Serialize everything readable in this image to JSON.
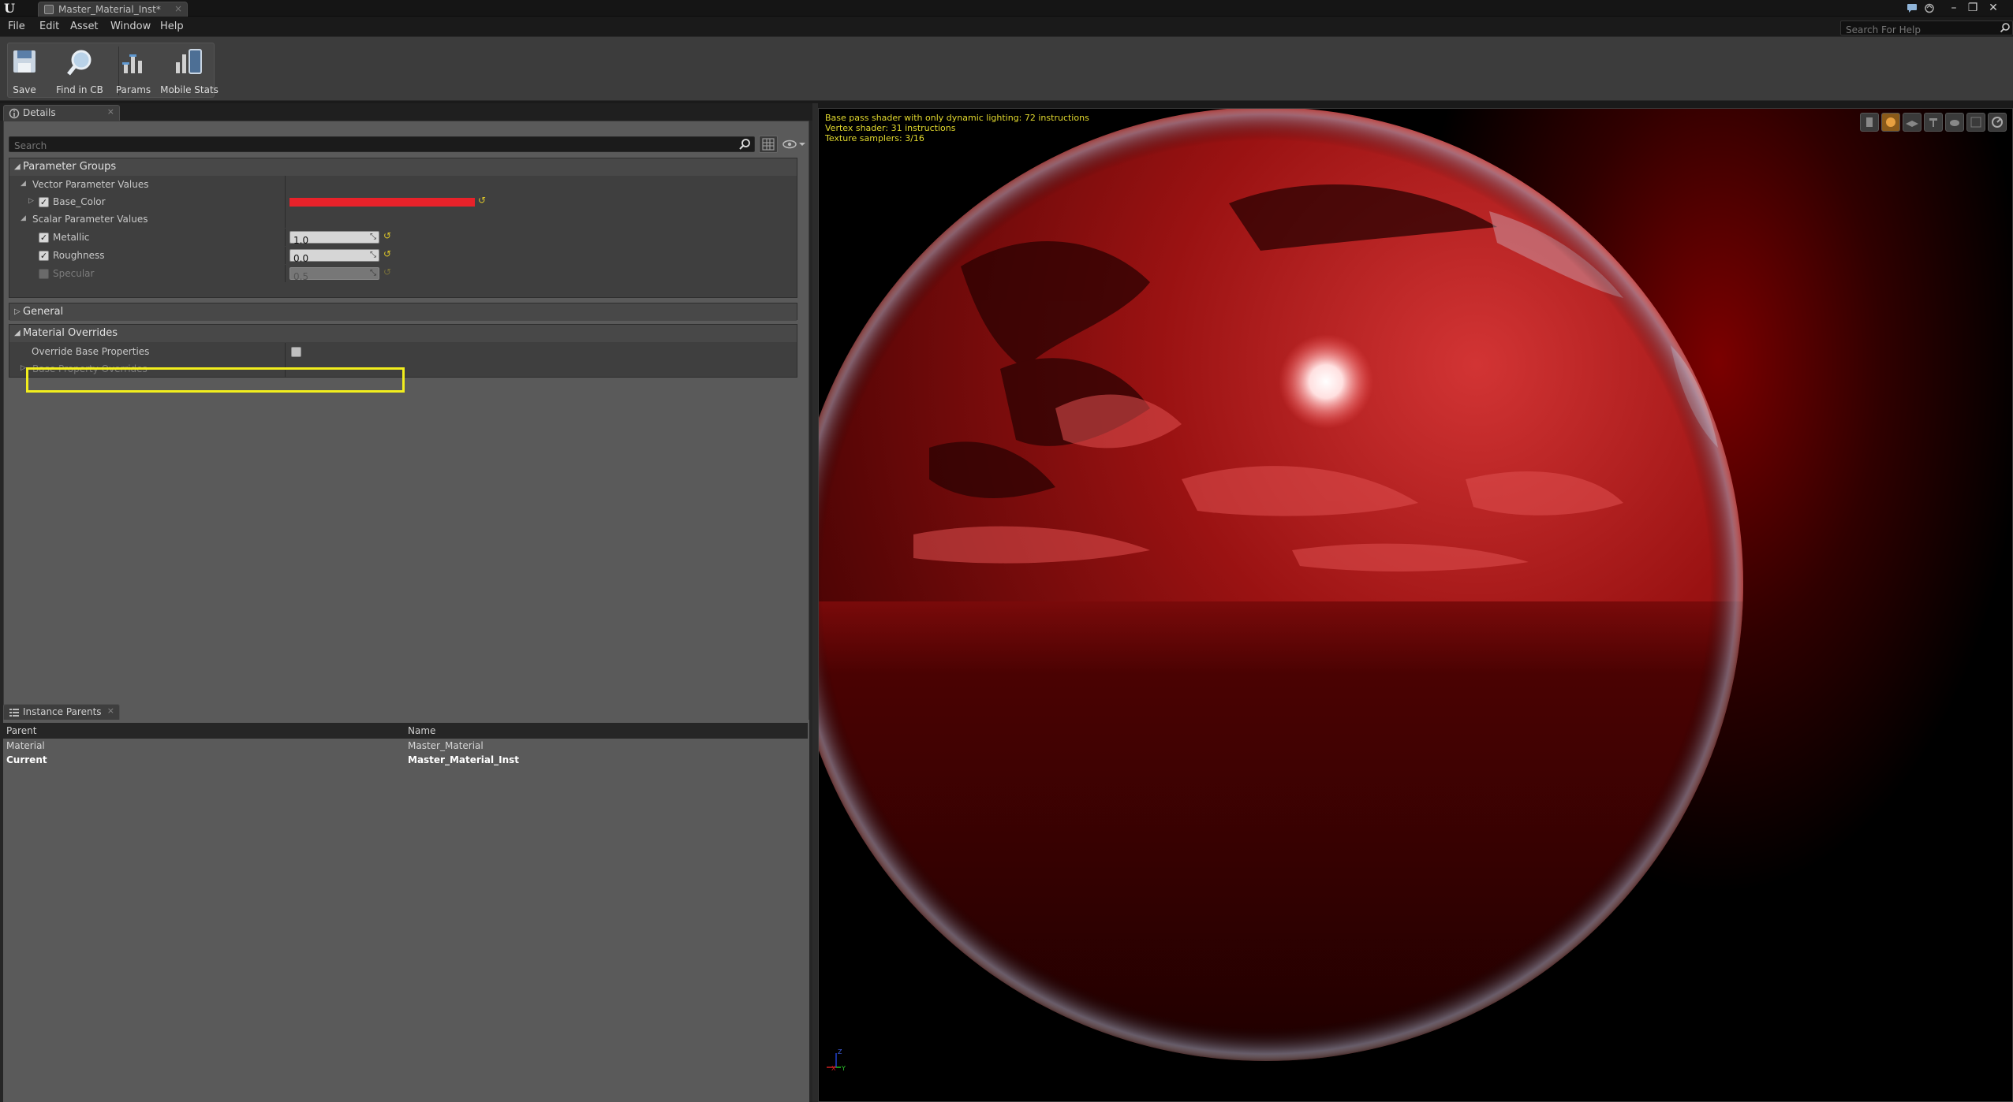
{
  "window": {
    "tab_title": "Master_Material_Inst*",
    "help_search_placeholder": "Search For Help"
  },
  "menu": [
    "File",
    "Edit",
    "Asset",
    "Window",
    "Help"
  ],
  "toolbar": {
    "save": "Save",
    "find_in_cb": "Find in CB",
    "params": "Params",
    "mobile_stats": "Mobile Stats"
  },
  "details": {
    "tab_label": "Details",
    "search_placeholder": "Search",
    "parameter_groups": "Parameter Groups",
    "vector_parameter_values": "Vector Parameter Values",
    "base_color_label": "Base_Color",
    "base_color": "#e8222a",
    "scalar_parameter_values": "Scalar Parameter Values",
    "metallic_label": "Metallic",
    "metallic_value": "1.0",
    "roughness_label": "Roughness",
    "roughness_value": "0.0",
    "specular_label": "Specular",
    "specular_value": "0.5",
    "general": "General",
    "material_overrides": "Material Overrides",
    "override_base_properties": "Override Base Properties",
    "base_property_overrides": "Base Property Overrides"
  },
  "instance_parents": {
    "tab_label": "Instance Parents",
    "col_parent": "Parent",
    "col_name": "Name",
    "rows": [
      {
        "parent": "Material",
        "name": "Master_Material"
      },
      {
        "parent": "Current",
        "name": "Master_Material_Inst"
      }
    ]
  },
  "viewport": {
    "stats": [
      "Base pass shader with only dynamic lighting: 72 instructions",
      "Vertex shader: 31 instructions",
      "Texture samplers: 3/16"
    ],
    "axis_x": "X",
    "axis_y": "Y",
    "axis_z": "Z"
  }
}
